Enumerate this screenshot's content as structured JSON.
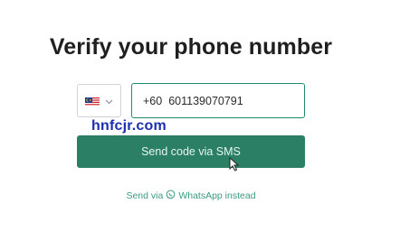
{
  "header": {
    "title": "Verify your phone number"
  },
  "phone_form": {
    "country": {
      "flag_icon": "malaysia-flag-icon",
      "chevron_icon": "chevron-down-icon"
    },
    "dial_code": "+60",
    "phone_value": "601139070791",
    "send_button_label": "Send code via SMS",
    "alt_prefix": "Send via",
    "alt_icon": "whatsapp-icon",
    "alt_label": "WhatsApp instead"
  },
  "overlay": {
    "watermark_text": "hnfcjr.com"
  },
  "colors": {
    "accent": "#2a7f65",
    "link": "#3a9a7e",
    "watermark": "#1c2fb0",
    "title": "#1f1f1f"
  }
}
